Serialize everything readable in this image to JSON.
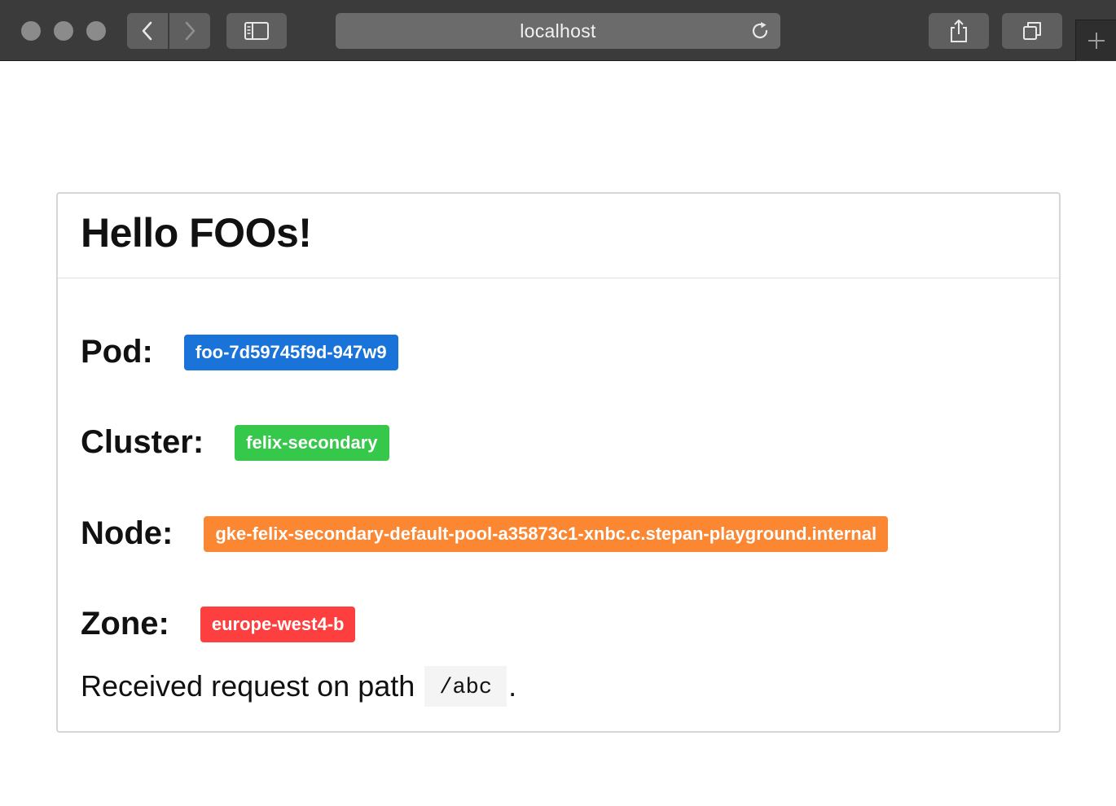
{
  "browser": {
    "address": "localhost",
    "icons": {
      "back": "chevron-left-icon",
      "forward": "chevron-right-icon",
      "sidebar": "sidebar-icon",
      "reload": "reload-icon",
      "share": "share-icon",
      "tabs": "tabs-overview-icon",
      "new_tab": "plus-icon"
    }
  },
  "card": {
    "title": "Hello FOOs!",
    "rows": [
      {
        "label": "Pod:",
        "value": "foo-7d59745f9d-947w9",
        "color": "#1a73d9"
      },
      {
        "label": "Cluster:",
        "value": "felix-secondary",
        "color": "#35c84a"
      },
      {
        "label": "Node:",
        "value": "gke-felix-secondary-default-pool-a35873c1-xnbc.c.stepan-playground.internal",
        "color": "#fb8733"
      },
      {
        "label": "Zone:",
        "value": "europe-west4-b",
        "color": "#fd403f"
      }
    ],
    "request": {
      "text": "Received request on path",
      "path": "/abc",
      "suffix": "."
    }
  }
}
